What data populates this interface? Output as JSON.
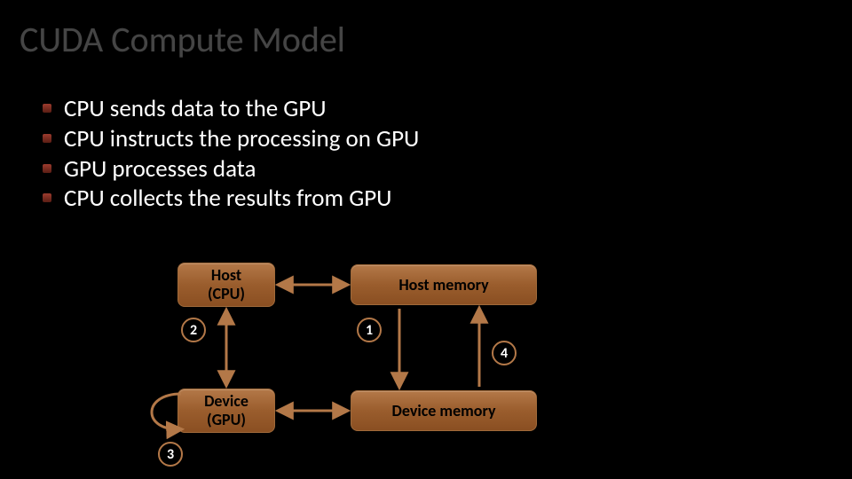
{
  "title": "CUDA Compute Model",
  "bullets": [
    "CPU sends data to the GPU",
    "CPU instructs the processing on GPU",
    "GPU processes data",
    "CPU collects the results from GPU"
  ],
  "boxes": {
    "host_cpu": "Host\n(CPU)",
    "device_gpu": "Device\n(GPU)",
    "host_mem": "Host memory",
    "device_mem": "Device memory"
  },
  "steps": {
    "s1": "1",
    "s2": "2",
    "s3": "3",
    "s4": "4"
  },
  "colors": {
    "accent": "#b37848"
  }
}
